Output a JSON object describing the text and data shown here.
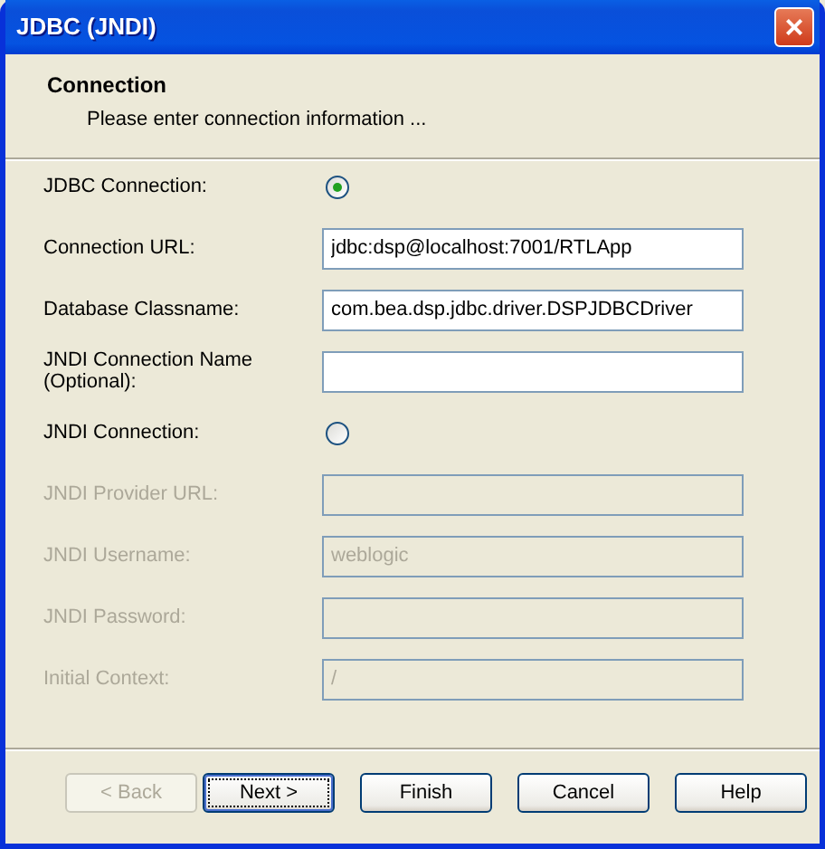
{
  "window": {
    "title": "JDBC (JNDI)",
    "close": "×"
  },
  "header": {
    "title": "Connection",
    "subtitle": "Please enter connection information ..."
  },
  "fields": [
    {
      "kind": "radio",
      "label": "JDBC Connection:",
      "checked": true,
      "disabled": false
    },
    {
      "kind": "text",
      "label": "Connection URL:",
      "value": "jdbc:dsp@localhost:7001/RTLApp",
      "disabled": false
    },
    {
      "kind": "text",
      "label": "Database Classname:",
      "value": "com.bea.dsp.jdbc.driver.DSPJDBCDriver",
      "disabled": false
    },
    {
      "kind": "text",
      "label": "JNDI Connection Name (Optional):",
      "disabled": false
    },
    {
      "kind": "radio",
      "label": "JNDI Connection:",
      "checked": false,
      "disabled": false
    },
    {
      "kind": "text",
      "label": "JNDI Provider URL:",
      "disabled": true
    },
    {
      "kind": "text",
      "label": "JNDI Username:",
      "value": "weblogic",
      "disabled": true
    },
    {
      "kind": "text",
      "label": "JNDI Password:",
      "disabled": true
    },
    {
      "kind": "text",
      "label": "Initial Context:",
      "value": "/",
      "disabled": true
    }
  ],
  "buttons": [
    {
      "label": "< Back",
      "disabled": true,
      "default": false
    },
    {
      "label": "Next >",
      "disabled": false,
      "default": true
    },
    {
      "label": "Finish",
      "disabled": false,
      "default": false
    },
    {
      "label": "Cancel",
      "disabled": false,
      "default": false
    },
    {
      "label": "Help",
      "disabled": false,
      "default": false
    }
  ]
}
